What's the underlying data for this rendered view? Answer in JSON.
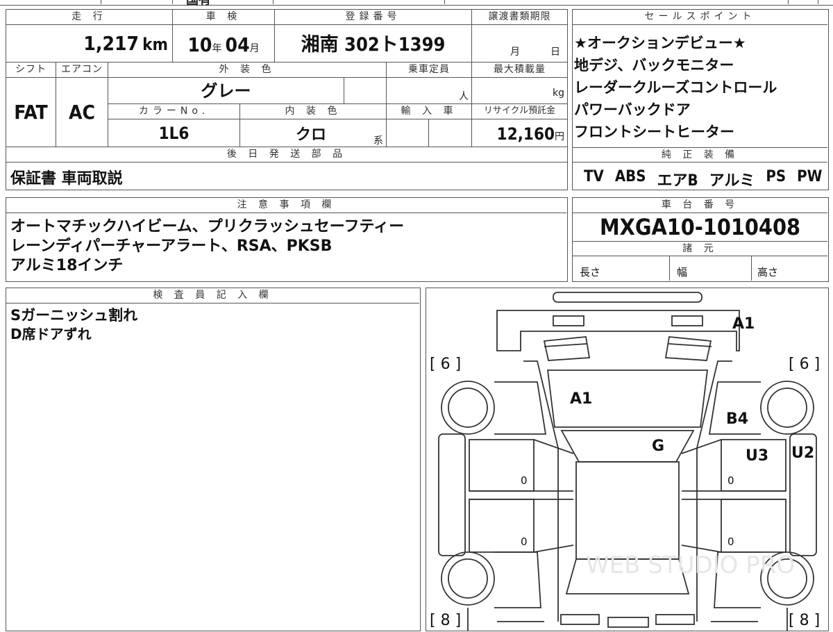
{
  "top_strip": {
    "fragment": "国有"
  },
  "main": {
    "headers": {
      "mileage": "走 行",
      "inspection": "車 検",
      "registration": "登録番号",
      "transfer_deadline": "譲渡書類期限",
      "shift": "シフト",
      "aircon": "エアコン",
      "exterior_color": "外 装 色",
      "capacity": "乗車定員",
      "max_load": "最大積載量",
      "color_no": "カラーNo.",
      "interior_color": "内 装 色",
      "import_car": "輸 入 車",
      "recycle_fee": "リサイクル預託金",
      "later_parts": "後 日 発 送 部 品"
    },
    "mileage_value": "1,217",
    "mileage_unit": "km",
    "inspection_year": "10",
    "inspection_year_unit": "年",
    "inspection_month": "04",
    "inspection_month_unit": "月",
    "registration_value": "湘南 302ト1399",
    "deadline_month_unit": "月",
    "deadline_day_unit": "日",
    "shift_value": "FAT",
    "aircon_value": "AC",
    "exterior_color_value": "グレー",
    "capacity_unit": "人",
    "max_load_unit": "kg",
    "color_no_value": "1L6",
    "interior_color_value": "クロ",
    "interior_color_suffix": "系",
    "recycle_value": "12,160",
    "recycle_unit": "円",
    "later_parts_value": "保証書 車両取説"
  },
  "sales_points": {
    "header": "セールスポイント",
    "items": [
      "★オークションデビュー★",
      "地デジ、バックモニター",
      "レーダークルーズコントロール",
      "パワーバックドア",
      "フロントシートヒーター"
    ]
  },
  "equipment": {
    "header": "純 正 装 備",
    "items": [
      "TV",
      "ABS",
      "エアB",
      "アルミ",
      "PS",
      "PW"
    ]
  },
  "notes": {
    "header": "注 意 事 項 欄",
    "lines": [
      "オートマチックハイビーム、プリクラッシュセーフティー",
      "レーンディパーチャーアラート、RSA、PKSB",
      "アルミ18インチ"
    ]
  },
  "chassis": {
    "header": "車 台 番 号",
    "value": "MXGA10-1010408"
  },
  "specs": {
    "header": "諸 元",
    "length": "長さ",
    "width": "幅",
    "height": "高さ"
  },
  "inspector": {
    "header": "検 査 員 記 入 欄",
    "lines": [
      "Sガーニッシュ割れ",
      "D席ドアずれ"
    ]
  },
  "diagram": {
    "labels": {
      "roof": "A1",
      "hood": "A1",
      "windshield": "G",
      "right_fender": "B4",
      "right_front_door": "U3",
      "right_sill": "U2"
    },
    "tire_left_front": "[ 6 ]",
    "tire_right_front": "[ 6 ]",
    "tire_left_rear": "[ 8 ]",
    "tire_right_rear": "[ 8 ]",
    "zero_marks": [
      "0",
      "0",
      "0",
      "0"
    ],
    "watermark": "WEB STUDIO PRO"
  },
  "colors": {
    "border": "#555555",
    "text": "#111111"
  }
}
